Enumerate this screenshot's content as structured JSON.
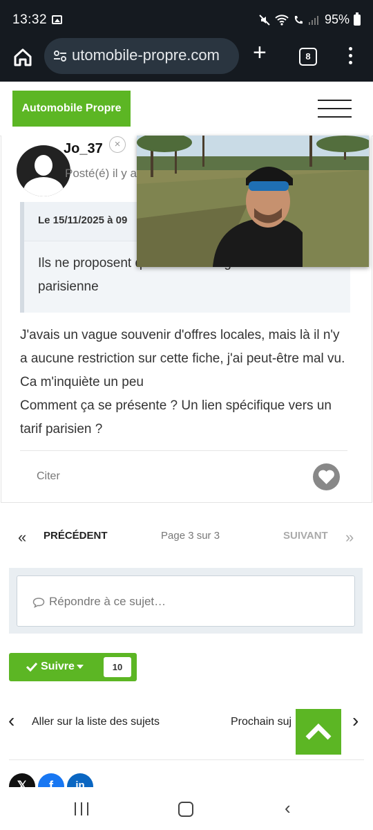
{
  "status_bar": {
    "time": "13:32",
    "battery": "95%"
  },
  "browser": {
    "url": "utomobile-propre.com",
    "tab_count": "8"
  },
  "site": {
    "logo": "Automobile Propre"
  },
  "post": {
    "author": "Jo_37",
    "posted": "Posté(é) il y a",
    "quote_header": "Le 15/11/2025 à 09",
    "quote_text": "Ils ne proposent que 10 % en région parisienne",
    "body": [
      "J'avais un vague souvenir d'offres locales, mais là il n'y a aucune restriction sur cette fiche, j'ai peut-être mal vu. Ca m'inquiète un peu",
      "Comment ça se présente ? Un lien spécifique vers un tarif parisien ?"
    ],
    "cite_label": "Citer"
  },
  "pagination": {
    "prev": "PRÉCÉDENT",
    "page": "Page 3 sur 3",
    "next": "SUIVANT"
  },
  "reply": {
    "placeholder": "Répondre à ce sujet…"
  },
  "follow": {
    "label": "Suivre",
    "count": "10"
  },
  "topic_nav": {
    "prev": "Aller sur la liste des sujets",
    "next": "Prochain suj"
  },
  "colors": {
    "brand_green": "#5cb624",
    "status_bg": "#151a20"
  }
}
